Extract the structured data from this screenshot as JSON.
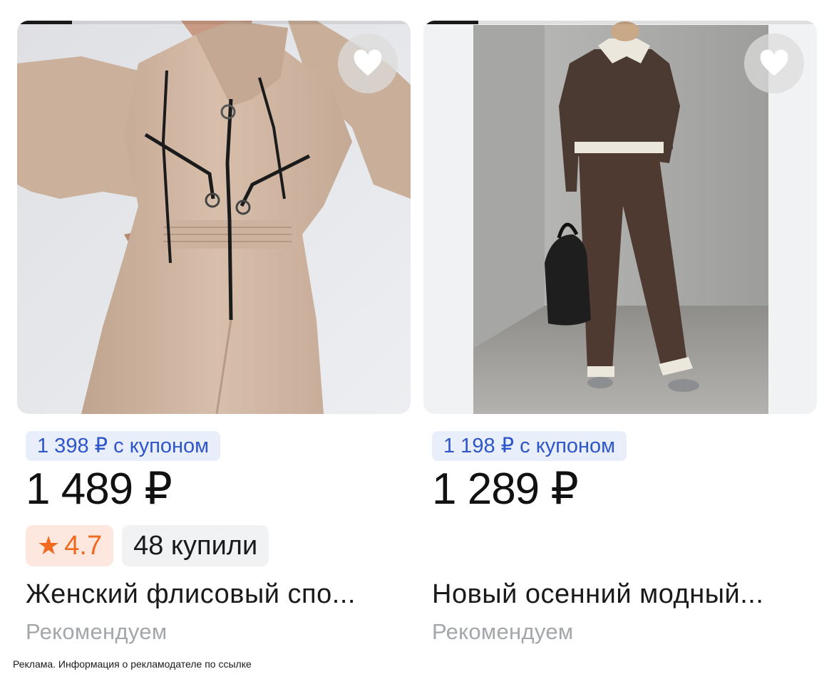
{
  "products": [
    {
      "image_desc": "woman in beige fleece hooded jumpsuit",
      "coupon_price": "1 398 ₽ с купоном",
      "price": "1 489 ₽",
      "rating": "4.7",
      "purchases": "48 купили",
      "title": "Женский флисовый спо...",
      "recommended": "Рекомендуем",
      "favorite_icon": "heart-icon"
    },
    {
      "image_desc": "woman in brown tracksuit with black bag",
      "coupon_price": "1 198 ₽ с купоном",
      "price": "1 289 ₽",
      "title": "Новый осенний модный...",
      "recommended": "Рекомендуем",
      "favorite_icon": "heart-icon"
    }
  ],
  "ad_disclaimer": "Реклама. Информация о рекламодателе по ссылке",
  "colors": {
    "coupon_bg": "#e9eefb",
    "coupon_text": "#2f56c9",
    "rating_bg": "#fde7df",
    "rating_text": "#f06a1f",
    "secondary_text": "#a3a6ab"
  }
}
